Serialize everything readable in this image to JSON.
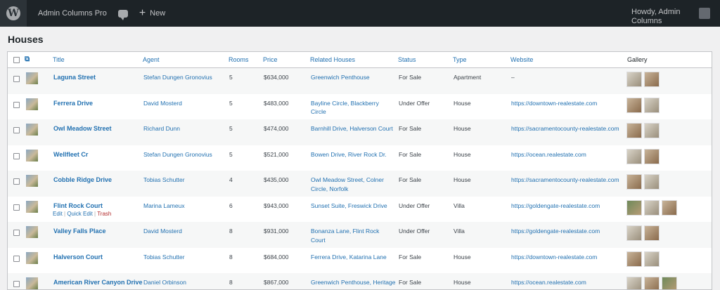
{
  "adminbar": {
    "site_name": "Admin Columns Pro",
    "new_label": "New",
    "howdy": "Howdy, Admin Columns"
  },
  "page": {
    "title": "Houses"
  },
  "columns": {
    "title": "Title",
    "agent": "Agent",
    "rooms": "Rooms",
    "price": "Price",
    "related": "Related Houses",
    "status": "Status",
    "type": "Type",
    "website": "Website",
    "gallery": "Gallery"
  },
  "row_actions": {
    "edit": "Edit",
    "quick_edit": "Quick Edit",
    "trash": "Trash"
  },
  "rows": [
    {
      "title": "Laguna Street",
      "agent": "Stefan Dungen Gronovius",
      "rooms": "5",
      "price": "$634,000",
      "related_1": "Greenwich Penthouse",
      "related_2": "",
      "status": "For Sale",
      "type": "Apartment",
      "website": "–"
    },
    {
      "title": "Ferrera Drive",
      "agent": "David Mosterd",
      "rooms": "5",
      "price": "$483,000",
      "related_1": "Bayline Circle, Blackberry",
      "related_2": "Circle",
      "status": "Under Offer",
      "type": "House",
      "website": "https://downtown-realestate.com"
    },
    {
      "title": "Owl Meadow Street",
      "agent": "Richard Dunn",
      "rooms": "5",
      "price": "$474,000",
      "related_1": "Barnhill Drive, Halverson Court",
      "related_2": "",
      "status": "For Sale",
      "type": "House",
      "website": "https://sacramentocounty-realestate.com"
    },
    {
      "title": "Wellfleet Cr",
      "agent": "Stefan Dungen Gronovius",
      "rooms": "5",
      "price": "$521,000",
      "related_1": "Bowen Drive, River Rock Dr.",
      "related_2": "",
      "status": "For Sale",
      "type": "House",
      "website": "https://ocean.realestate.com"
    },
    {
      "title": "Cobble Ridge Drive",
      "agent": "Tobias Schutter",
      "rooms": "4",
      "price": "$435,000",
      "related_1": "Owl Meadow Street, Colner",
      "related_2": "Circle, Norfolk",
      "status": "For Sale",
      "type": "House",
      "website": "https://sacramentocounty-realestate.com"
    },
    {
      "title": "Flint Rock Court",
      "agent": "Marina Lameux",
      "rooms": "6",
      "price": "$943,000",
      "related_1": "Sunset Suite, Freswick Drive",
      "related_2": "",
      "status": "Under Offer",
      "type": "Villa",
      "website": "https://goldengate-realestate.com"
    },
    {
      "title": "Valley Falls Place",
      "agent": "David Mosterd",
      "rooms": "8",
      "price": "$931,000",
      "related_1": "Bonanza Lane, Flint Rock",
      "related_2": "Court",
      "status": "Under Offer",
      "type": "Villa",
      "website": "https://goldengate-realestate.com"
    },
    {
      "title": "Halverson Court",
      "agent": "Tobias Schutter",
      "rooms": "8",
      "price": "$684,000",
      "related_1": "Ferrera Drive, Katarina Lane",
      "related_2": "",
      "status": "For Sale",
      "type": "House",
      "website": "https://downtown-realestate.com"
    },
    {
      "title": "American River Canyon Drive",
      "agent": "Daniel Orbinson",
      "rooms": "8",
      "price": "$867,000",
      "related_1": "Greenwich Penthouse, Heritage",
      "related_2": "",
      "status": "For Sale",
      "type": "House",
      "website": "https://ocean.realestate.com"
    }
  ]
}
